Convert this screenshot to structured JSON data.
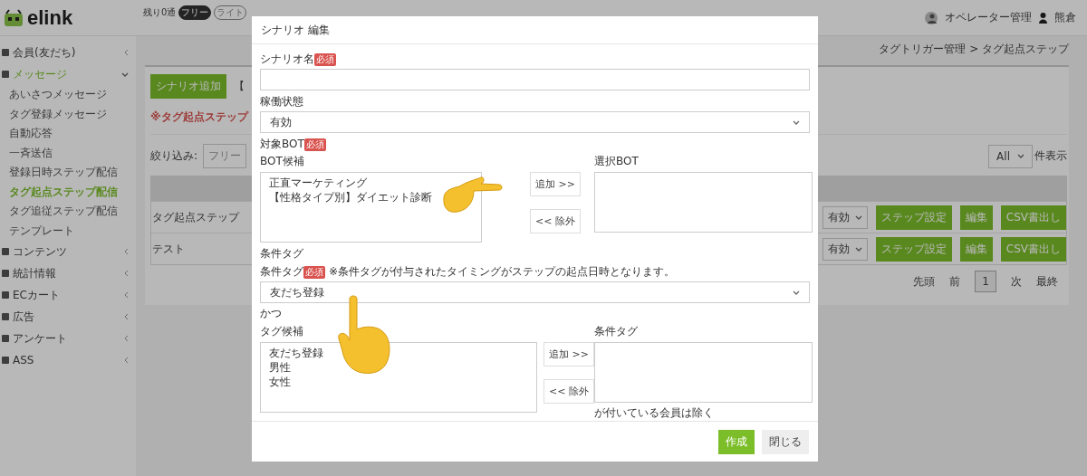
{
  "header": {
    "logo": "elink",
    "remaining": "残り0通",
    "plans": [
      {
        "label": "フリー",
        "selected": true
      },
      {
        "label": "ライト",
        "selected": false
      }
    ],
    "operator": "オペレーター管理",
    "user": "熊倉"
  },
  "sidebar": {
    "items": [
      {
        "label": "会員(友だち)",
        "expanded": false,
        "selected": false
      },
      {
        "label": "メッセージ",
        "expanded": true,
        "selected": true,
        "children": [
          {
            "label": "あいさつメッセージ",
            "selected": false
          },
          {
            "label": "タグ登録メッセージ",
            "selected": false
          },
          {
            "label": "自動応答",
            "selected": false
          },
          {
            "label": "一斉送信",
            "selected": false
          },
          {
            "label": "登録日時ステップ配信",
            "selected": false
          },
          {
            "label": "タグ起点ステップ配信",
            "selected": true
          },
          {
            "label": "タグ追従ステップ配信",
            "selected": false
          },
          {
            "label": "テンプレート",
            "selected": false
          }
        ]
      },
      {
        "label": "コンテンツ",
        "expanded": false,
        "selected": false
      },
      {
        "label": "統計情報",
        "expanded": false,
        "selected": false
      },
      {
        "label": "ECカート",
        "expanded": false,
        "selected": false
      },
      {
        "label": "広告",
        "expanded": false,
        "selected": false
      },
      {
        "label": "アンケート",
        "expanded": false,
        "selected": false
      },
      {
        "label": "ASS",
        "expanded": false,
        "selected": false
      }
    ]
  },
  "breadcrumb": "タグトリガー管理 > タグ起点ステップ",
  "page": {
    "add_button": "シナリオ追加",
    "bracket_text": "【",
    "notice": "※タグ起点ステップ",
    "filter_label": "絞り込み:",
    "filter_placeholder": "フリー",
    "page_size": "All",
    "page_size_suffix": "件表示",
    "rows": [
      {
        "name": "タグ起点ステップ",
        "status": "有効",
        "step_button": "ステップ設定",
        "edit_button": "編集",
        "csv_button": "CSV書出し"
      },
      {
        "name": "テスト",
        "status": "有効",
        "step_button": "ステップ設定",
        "edit_button": "編集",
        "csv_button": "CSV書出し"
      }
    ],
    "pagination": [
      {
        "label": "先頭",
        "selected": false
      },
      {
        "label": "前",
        "selected": false
      },
      {
        "label": "1",
        "selected": true
      },
      {
        "label": "次",
        "selected": false
      },
      {
        "label": "最終",
        "selected": false
      }
    ]
  },
  "modal": {
    "title": "シナリオ 編集",
    "name_label": "シナリオ名",
    "name_required": "必須",
    "status_label": "稼働状態",
    "status_value": "有効",
    "bot_label": "対象BOT",
    "bot_required": "必須",
    "bot_candidates_label": "BOT候補",
    "bot_candidates": [
      "正直マーケティング",
      "【性格タイプ別】ダイエット診断"
    ],
    "bot_selected_label": "選択BOT",
    "bot_add_button": "追加 >>",
    "bot_remove_button": "<< 除外",
    "tag_section_label": "条件タグ",
    "tag_label": "条件タグ",
    "tag_required": "必須",
    "tag_note": "※条件タグが付与されたタイミングがステップの起点日時となります。",
    "tag_value": "友だち登録",
    "and_label": "かつ",
    "tag_candidates_label": "タグ候補",
    "tag_candidates": [
      "友だち登録",
      "男性",
      "女性"
    ],
    "tag_add_button": "追加 >>",
    "tag_remove_button": "<< 除外",
    "tag_selected_label": "条件タグ",
    "exclude_note": "が付いている会員は除く",
    "create_button": "作成",
    "close_button": "閉じる"
  }
}
